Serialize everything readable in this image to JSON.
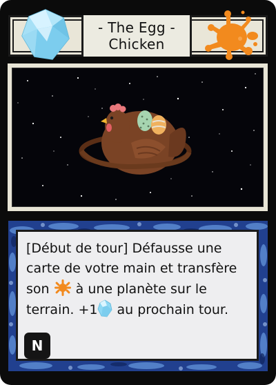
{
  "card": {
    "title_line1": "- The Egg -",
    "title_line2": "Chicken",
    "cost_icon": "crystal-gem-icon",
    "resource_icon": "orange-splat-icon",
    "art_subject": "chicken-planet-with-eggs",
    "rules": {
      "part1": "[Début de tour] Défausse une carte de votre main et transfère son ",
      "part2": " à une planète sur le terrain. +1",
      "part3": " au prochain tour."
    },
    "rarity": "N"
  },
  "colors": {
    "frame": "#0b0b0b",
    "header_bg": "#e9e6d8",
    "text_frame": "#1e3b8c",
    "gem": "#7fd0ee",
    "splat": "#f28a1e",
    "chicken": "#7a4325"
  }
}
